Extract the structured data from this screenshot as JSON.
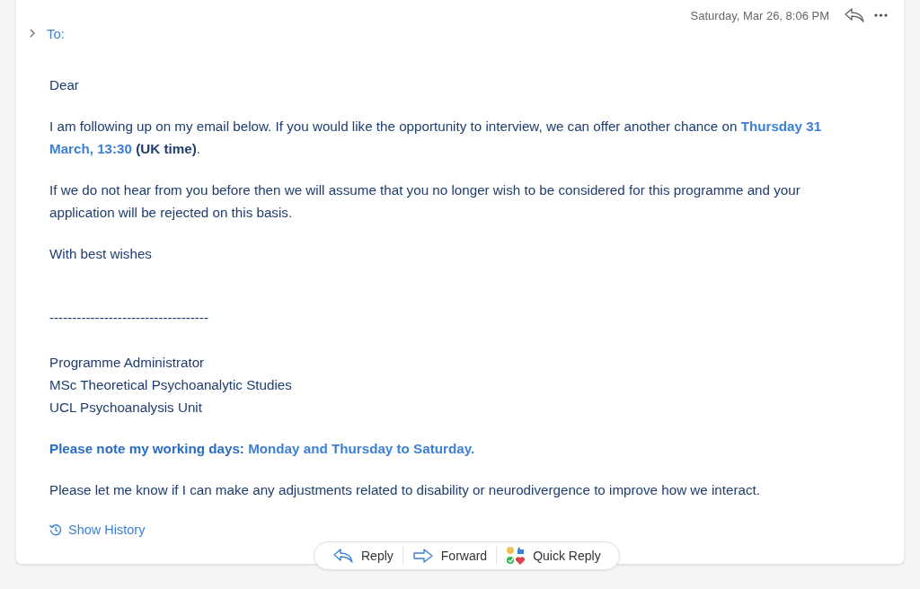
{
  "header": {
    "date": "Saturday, Mar 26, 8:06 PM",
    "to_label": "To:",
    "recipients_expanded": false
  },
  "body": [
    {
      "kind": "paragraph",
      "runs": [
        {
          "text": "Dear",
          "kind": "plain"
        }
      ]
    },
    {
      "kind": "paragraph",
      "runs": [
        {
          "text": "I am following up on my email below. If you would like the opportunity to interview, we can offer another chance on ",
          "kind": "plain"
        },
        {
          "text": "Thursday 31 March, 13:30",
          "kind": "highlight"
        },
        {
          "text": " (UK time)",
          "kind": "strong"
        },
        {
          "text": ".",
          "kind": "plain"
        }
      ]
    },
    {
      "kind": "paragraph",
      "runs": [
        {
          "text": "If we do not hear from you before then we will assume that you no longer wish to be considered for this programme and your application will be rejected on this basis.",
          "kind": "plain"
        }
      ]
    },
    {
      "kind": "paragraph",
      "runs": [
        {
          "text": "With best wishes",
          "kind": "plain"
        }
      ]
    },
    {
      "kind": "rule",
      "runs": [
        {
          "text": "-----------------------------------",
          "kind": "plain"
        }
      ]
    },
    {
      "kind": "signature",
      "lines": [
        "Programme Administrator",
        "MSc Theoretical Psychoanalytic Studies",
        "UCL Psychoanalysis Unit"
      ]
    },
    {
      "kind": "paragraph",
      "runs": [
        {
          "text": "Please note my working days: ",
          "kind": "notice"
        },
        {
          "text": "Monday and Thursday to Saturday.",
          "kind": "highlight"
        }
      ]
    },
    {
      "kind": "paragraph",
      "runs": [
        {
          "text": "Please let me know if I can make any adjustments related to disability or neurodivergence to improve how we interact.",
          "kind": "plain"
        }
      ]
    }
  ],
  "show_history": "Show History",
  "actions": [
    {
      "kind": "reply",
      "label": "Reply"
    },
    {
      "kind": "forward",
      "label": "Forward"
    },
    {
      "kind": "quick",
      "label": "Quick Reply"
    }
  ]
}
